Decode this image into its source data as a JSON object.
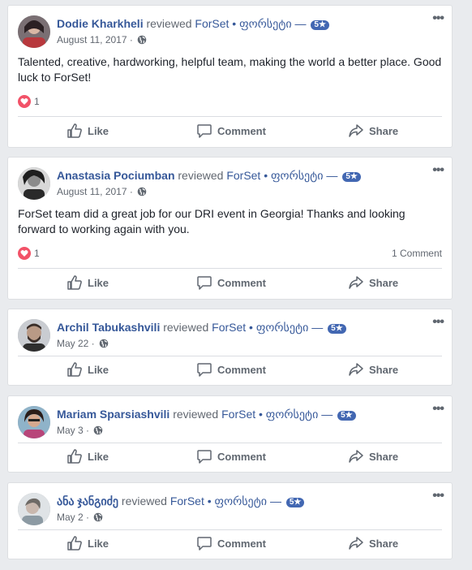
{
  "common": {
    "reviewed": "reviewed",
    "page_name": "ForSet",
    "page_alt": " • ფორსეტი — ",
    "rating": "5★",
    "like": "Like",
    "comment": "Comment",
    "share": "Share",
    "more": "•••"
  },
  "posts": [
    {
      "author": "Dodie Kharkheli",
      "date": "August 11, 2017 ·",
      "text": "Talented, creative, hardworking, helpful team, making the world a better place. Good luck to ForSet!",
      "reaction_count": "1",
      "comment_count": ""
    },
    {
      "author": "Anastasia Pociumban",
      "date": "August 11, 2017 ·",
      "text": "ForSet team did a great job for our DRI event in Georgia! Thanks and looking forward to working again with you.",
      "reaction_count": "1",
      "comment_count": "1 Comment"
    },
    {
      "author": "Archil Tabukashvili",
      "date": "May 22 ·",
      "text": "",
      "reaction_count": "",
      "comment_count": ""
    },
    {
      "author": "Mariam Sparsiashvili",
      "date": "May 3 ·",
      "text": "",
      "reaction_count": "",
      "comment_count": ""
    },
    {
      "author": "ანა ჯანგიძე",
      "date": "May 2 ·",
      "text": "",
      "reaction_count": "",
      "comment_count": ""
    }
  ],
  "colors": {
    "link": "#365899",
    "badge": "#4267b2",
    "love": "#f25268",
    "background": "#e9ebee"
  },
  "icons": [
    "globe-icon",
    "more-icon",
    "heart-icon",
    "like-icon",
    "comment-icon",
    "share-icon"
  ]
}
